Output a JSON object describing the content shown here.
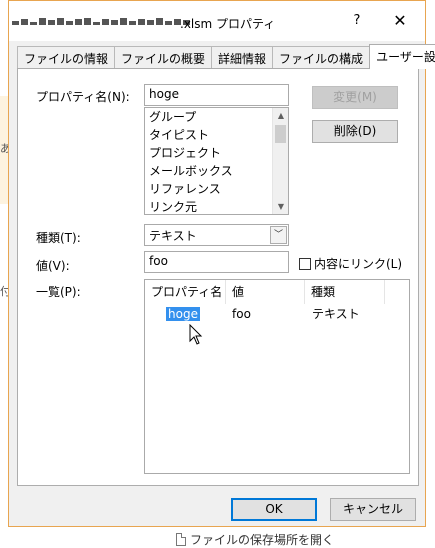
{
  "background": {
    "left_chars": [
      "あ",
      "付"
    ],
    "bottom_link": "ファイルの保存場所を開く"
  },
  "dialog": {
    "title": ".xlsm プロパティ",
    "help_glyph": "?",
    "close_glyph": "✕",
    "tabs": [
      {
        "label": "ファイルの情報",
        "active": false
      },
      {
        "label": "ファイルの概要",
        "active": false
      },
      {
        "label": "詳細情報",
        "active": false
      },
      {
        "label": "ファイルの構成",
        "active": false
      },
      {
        "label": "ユーザー設定",
        "active": true
      }
    ]
  },
  "custom": {
    "name_label": "プロパティ名(N):",
    "name_value": "hoge",
    "name_options": [
      "グループ",
      "タイピスト",
      "プロジェクト",
      "メールボックス",
      "リファレンス",
      "リンク元"
    ],
    "modify_button": "変更(M)",
    "delete_button": "削除(D)",
    "type_label": "種類(T):",
    "type_value": "テキスト",
    "value_label": "値(V):",
    "value_value": "foo",
    "link_checkbox_label": "内容にリンク(L)",
    "link_checked": false,
    "list_label": "一覧(P):",
    "list_columns": [
      "プロパティ名",
      "値",
      "種類"
    ],
    "list_rows": [
      {
        "name": "hoge",
        "value": "foo",
        "type": "テキスト",
        "selected": true
      }
    ]
  },
  "footer": {
    "ok_button": "OK",
    "cancel_button": "キャンセル"
  }
}
